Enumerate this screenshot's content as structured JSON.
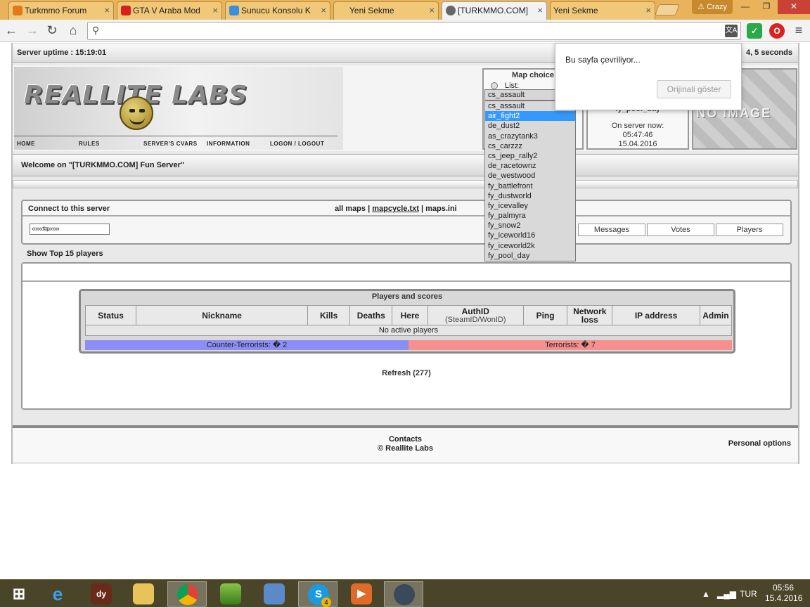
{
  "browser": {
    "tabs": [
      {
        "title": "Turkmmo Forum",
        "favicon_color": "#e07a1a"
      },
      {
        "title": "GTA V Araba Mod",
        "favicon_color": "#d81f1f"
      },
      {
        "title": "Sunucu Konsolu K",
        "favicon_color": "#3a8edb"
      },
      {
        "title": "Yeni Sekme",
        "favicon_color": ""
      },
      {
        "title": "[TURKMMO.COM]",
        "favicon_color": "#666666"
      },
      {
        "title": "Yeni Sekme",
        "favicon_color": ""
      }
    ],
    "active_tab_index": 4,
    "profile_name": "Crazy",
    "address_value": "",
    "translate_popup": {
      "message": "Bu sayfa çevriliyor...",
      "button": "Orijinali göster"
    }
  },
  "site": {
    "uptime": "Server uptime : 15:19:01",
    "uptime_right": "4, 5 seconds",
    "logo": "REALLITE LABS",
    "menu": [
      "HOME",
      "RULES",
      "SERVER'S CVARS",
      "INFORMATION",
      "LOGON / LOGOUT"
    ],
    "map_choice": {
      "title": "Map choice",
      "list_label": "List:",
      "selected": "cs_assault",
      "options": [
        "cs_assault",
        "air_fight2",
        "de_dust2",
        "as_crazytank3",
        "cs_carzzz",
        "cs_jeep_rally2",
        "de_racetownz",
        "de_westwood",
        "fy_battlefront",
        "fy_dustworld",
        "fy_icevalley",
        "fy_palmyra",
        "fy_snow2",
        "fy_iceworld16",
        "fy_iceworld2k",
        "fy_pool_day"
      ],
      "highlighted_index": 1
    },
    "current_map": {
      "name": "fy_pool_day",
      "now_label": "On server now:",
      "time": "05:47:46",
      "date": "15.04.2016"
    },
    "no_image_text": "NO IMAGE",
    "welcome": "Welcome on \"[TURKMMO.COM] Fun Server\"",
    "connect": {
      "title": "Connect to this server",
      "all_maps": "all maps",
      "sep1": "|",
      "mapcycle": "mapcycle.txt",
      "sep2": "|",
      "mapsini": "maps.ini",
      "nav_arrows": "«««⇆»»»",
      "tabs": [
        "Messages",
        "Votes",
        "Players"
      ]
    },
    "top15": "Show Top 15 players",
    "scores": {
      "title": "Players and scores",
      "columns": [
        "Status",
        "Nickname",
        "Kills",
        "Deaths",
        "Here",
        "AuthID",
        "Ping",
        "Network loss",
        "IP address",
        "Admin"
      ],
      "authid_sub": "(SteamID/WonID)",
      "empty": "No active players",
      "ct_label": "Counter-Terrorists: � 2",
      "t_label": "Terrorists: � 7",
      "ct_color": "#8a8ef6",
      "t_color": "#f78f8f"
    },
    "refresh": "Refresh (277)",
    "footer": {
      "contacts": "Contacts",
      "copyright": "© Reallite Labs",
      "personal": "Personal options"
    }
  },
  "taskbar": {
    "lang": "TUR",
    "time": "05:56",
    "date": "15.4.2016",
    "notification_count": "4"
  }
}
